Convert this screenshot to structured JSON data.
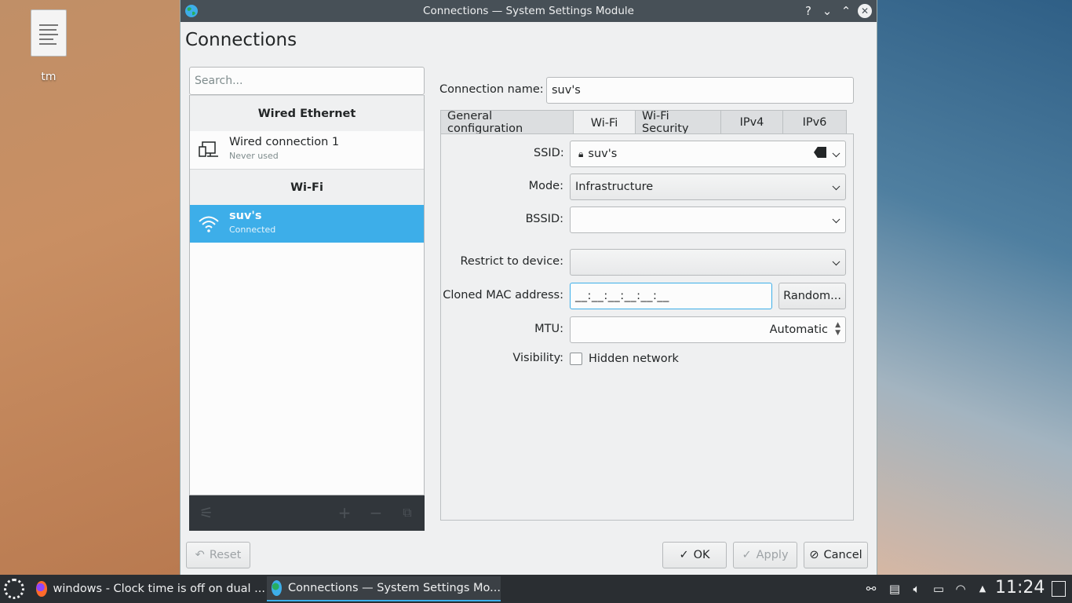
{
  "desktop": {
    "file_label": "tm"
  },
  "window": {
    "title": "Connections — System Settings Module",
    "buttons": {
      "help": "?",
      "minimize": "⌄",
      "maximize": "⌃"
    },
    "page_title": "Connections"
  },
  "left_panel": {
    "search_placeholder": "Search...",
    "groups": [
      {
        "header": "Wired Ethernet",
        "items": [
          {
            "name": "Wired connection 1",
            "status": "Never used",
            "icon": "wired-network-icon",
            "selected": false
          }
        ]
      },
      {
        "header": "Wi-Fi",
        "items": [
          {
            "name": "suv's",
            "status": "Connected",
            "icon": "wifi-icon",
            "selected": true
          }
        ]
      }
    ]
  },
  "editor": {
    "connection_name_label": "Connection name:",
    "connection_name_value": "suv's",
    "tabs": [
      "General configuration",
      "Wi-Fi",
      "Wi-Fi Security",
      "IPv4",
      "IPv6"
    ],
    "active_tab": "Wi-Fi",
    "fields": {
      "ssid_label": "SSID:",
      "ssid_value": "suv's",
      "mode_label": "Mode:",
      "mode_value": "Infrastructure",
      "bssid_label": "BSSID:",
      "bssid_value": "",
      "restrict_label": "Restrict to device:",
      "restrict_value": "",
      "mac_label": "Cloned MAC address:",
      "mac_value": "__:__:__:__:__:__",
      "random_button": "Random...",
      "mtu_label": "MTU:",
      "mtu_value": "Automatic",
      "visibility_label": "Visibility:",
      "hidden_network_label": "Hidden network",
      "hidden_network_checked": false
    }
  },
  "footer": {
    "reset": "Reset",
    "ok": "OK",
    "apply": "Apply",
    "cancel": "Cancel"
  },
  "taskbar": {
    "tasks": [
      {
        "label": "windows - Clock time is off on dual ...",
        "icon": "firefox-icon",
        "active": false
      },
      {
        "label": "Connections — System Settings Mo...",
        "icon": "settings-globe-icon",
        "active": true
      }
    ],
    "clock": "11:24"
  },
  "colors": {
    "accent": "#3daee9",
    "titlebar": "#475057",
    "window_bg": "#eff0f1",
    "taskbar": "#2a2e32"
  }
}
